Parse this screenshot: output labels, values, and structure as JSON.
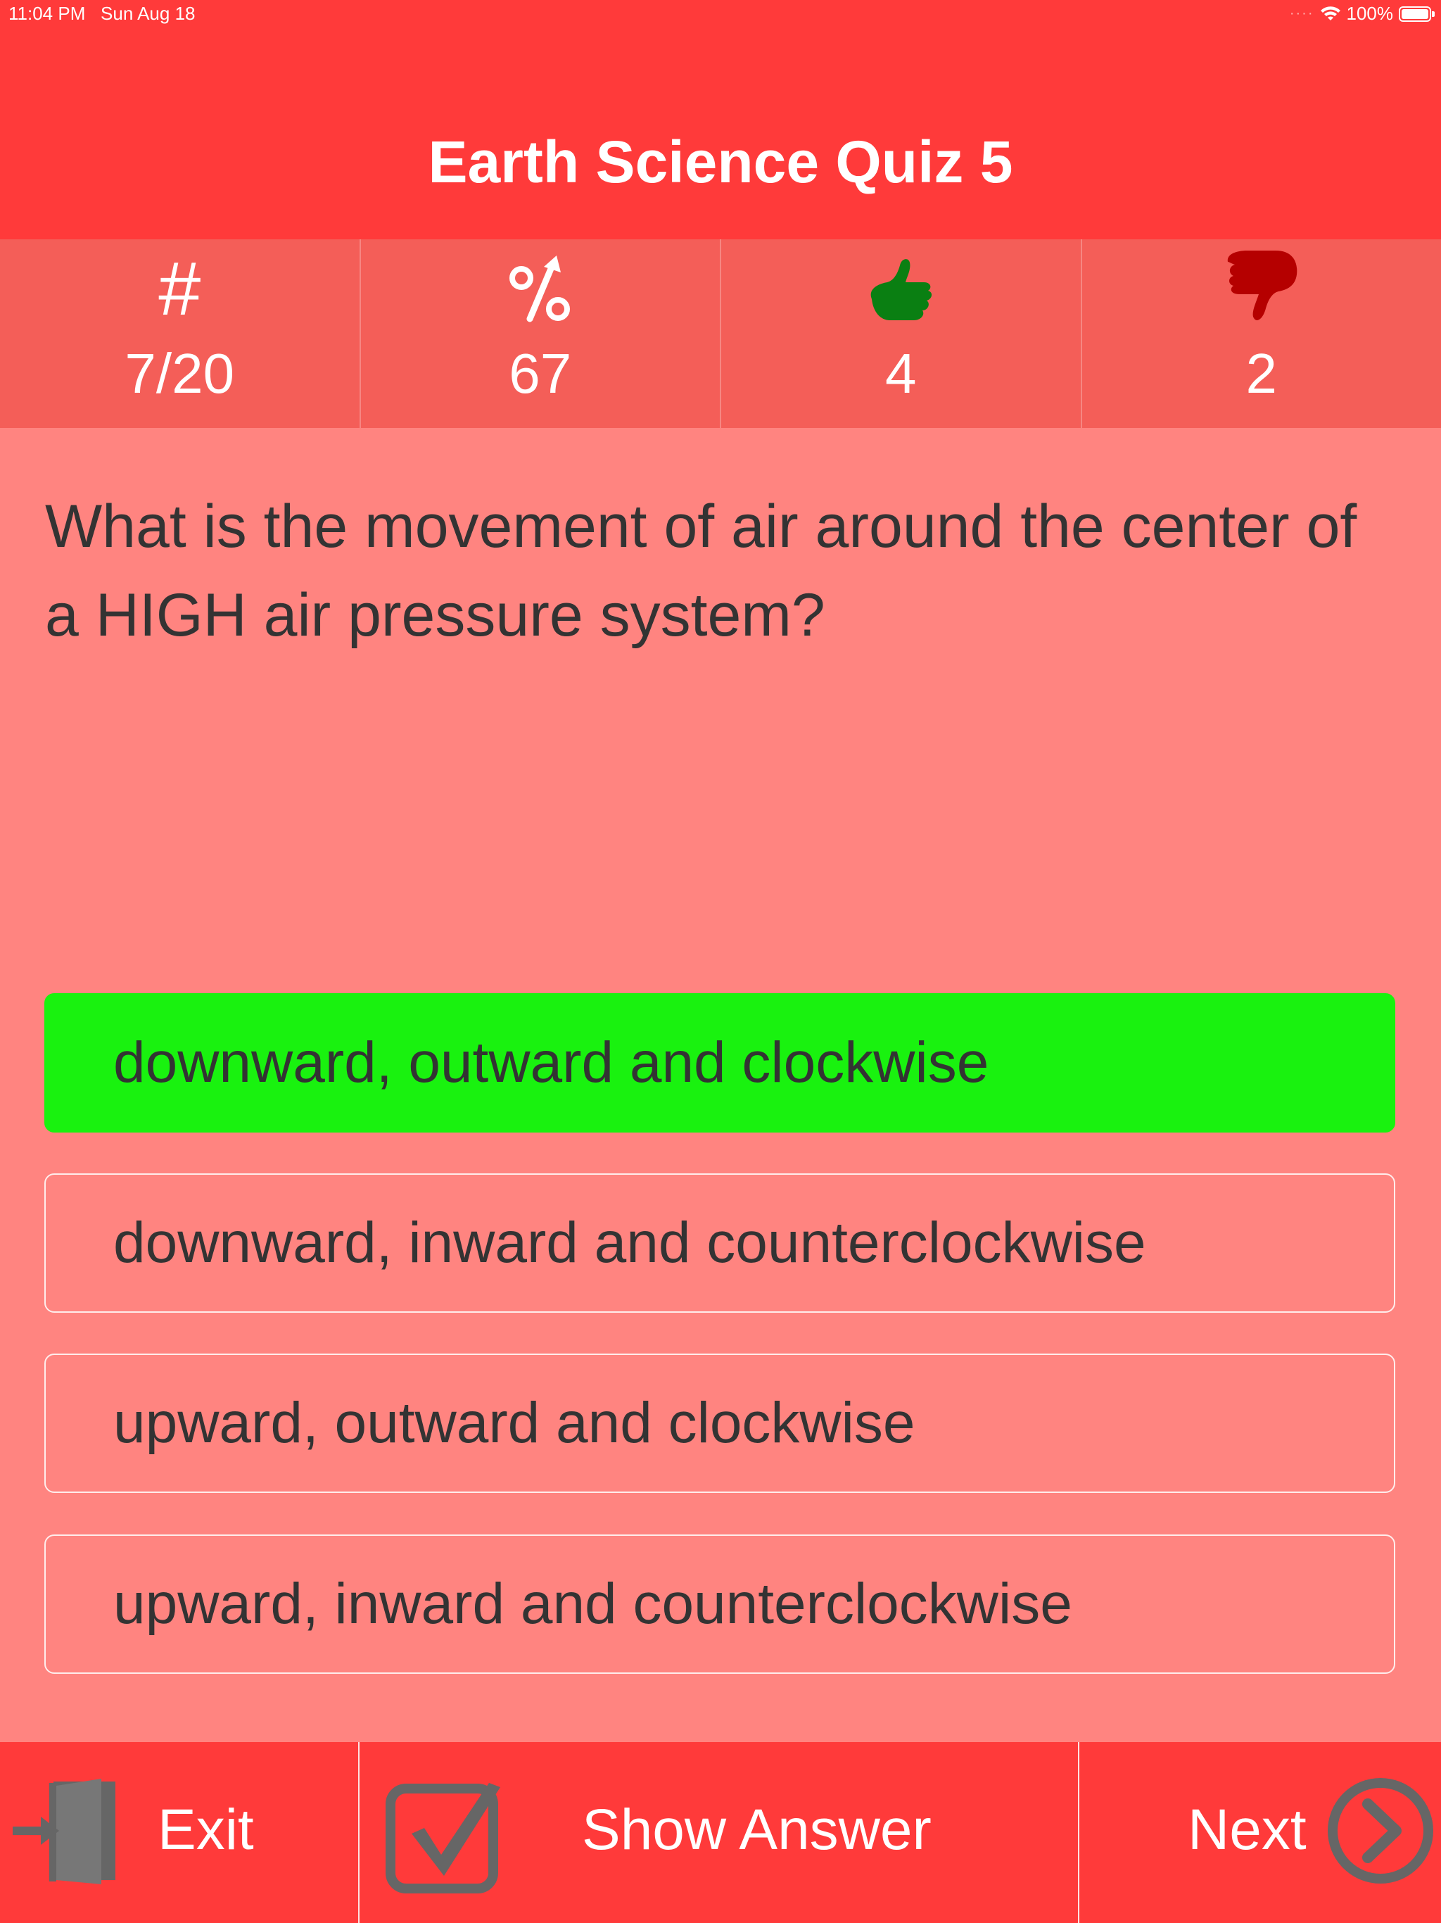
{
  "status_bar": {
    "time": "11:04 PM",
    "date": "Sun Aug 18",
    "battery": "100%",
    "signal_icon": "cellular-dots-icon",
    "wifi_icon": "wifi-icon"
  },
  "header": {
    "title": "Earth Science Quiz 5"
  },
  "stats": [
    {
      "icon": "hash-icon",
      "symbol": "#",
      "value": "7/20"
    },
    {
      "icon": "percent-trend-icon",
      "value": "67"
    },
    {
      "icon": "thumbs-up-icon",
      "value": "4"
    },
    {
      "icon": "thumbs-down-icon",
      "value": "2"
    }
  ],
  "question": {
    "text": "What is the movement of air around the center of a HIGH air pressure system?"
  },
  "answers": [
    {
      "text": "downward, outward and clockwise",
      "state": "correct"
    },
    {
      "text": "downward, inward and counterclockwise",
      "state": "normal"
    },
    {
      "text": "upward, outward and clockwise",
      "state": "normal"
    },
    {
      "text": "upward, inward and counterclockwise",
      "state": "normal"
    }
  ],
  "toolbar": {
    "exit_label": "Exit",
    "show_answer_label": "Show Answer",
    "next_label": "Next"
  },
  "colors": {
    "header_red": "#FF3A3A",
    "stats_bg": "#F45E58",
    "page_bg": "#FF8480",
    "correct_green": "#19F20F",
    "thumb_up": "#0A7F12",
    "thumb_down": "#B50000",
    "icon_gray": "#666666"
  }
}
